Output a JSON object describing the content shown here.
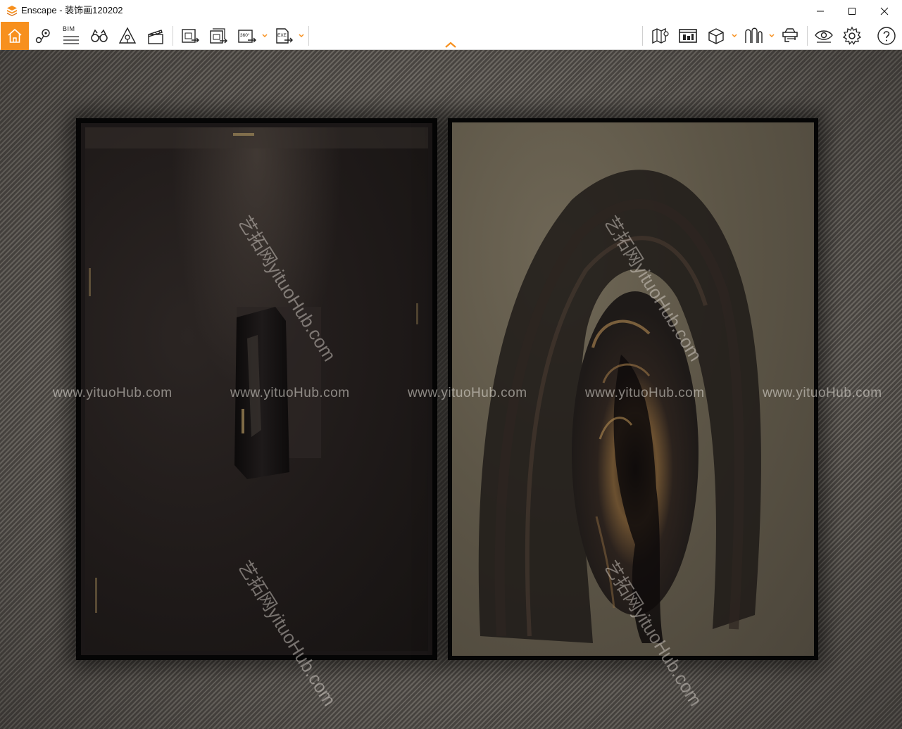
{
  "window": {
    "title": "Enscape - 装饰画120202",
    "controls": [
      "minimize-icon",
      "maximize-icon",
      "close-icon"
    ]
  },
  "toolbar": {
    "left_tools": [
      {
        "name": "home-icon",
        "active": true
      },
      {
        "name": "views-icon"
      },
      {
        "name": "bim-icon",
        "label": "BIM"
      },
      {
        "name": "binoculars-icon"
      },
      {
        "name": "atmosphere-icon"
      },
      {
        "name": "clapperboard-icon"
      },
      {
        "name": "render-screenshot-icon"
      },
      {
        "name": "batch-render-icon"
      },
      {
        "name": "panorama-360-icon",
        "label": "360°",
        "has_dropdown": true
      },
      {
        "name": "export-exe-icon",
        "label": "EXE",
        "has_dropdown": true
      }
    ],
    "right_tools": [
      {
        "name": "map-icon"
      },
      {
        "name": "asset-library-icon"
      },
      {
        "name": "cube-icon",
        "has_dropdown": true
      },
      {
        "name": "material-editor-icon",
        "has_dropdown": true
      },
      {
        "name": "vr-headset-icon"
      },
      {
        "name": "visibility-icon"
      },
      {
        "name": "settings-icon"
      },
      {
        "name": "help-icon"
      }
    ],
    "accent_color": "#f7901e"
  },
  "viewport": {
    "watermarks": {
      "horizontal": "www.yituoHub.com",
      "diagonal": "艺拓网yituoHub.com"
    }
  }
}
